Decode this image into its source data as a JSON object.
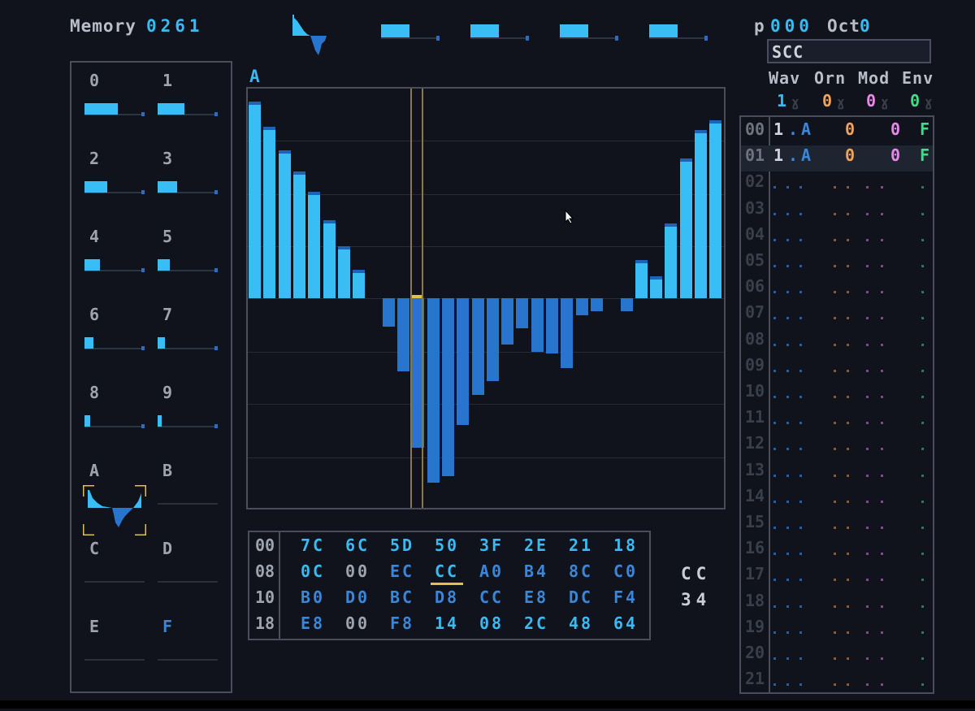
{
  "header": {
    "memory_label": "Memory",
    "memory_value": "0261",
    "pattern_label": "p",
    "pattern_value": "000",
    "octave_label": "Oct",
    "octave_value": "0"
  },
  "top_waves_fill": [
    0.48,
    0.48,
    0.48,
    0.48
  ],
  "slots": {
    "labels": [
      "0",
      "1",
      "2",
      "3",
      "4",
      "5",
      "6",
      "7",
      "8",
      "9",
      "A",
      "B",
      "C",
      "D",
      "E",
      "F"
    ],
    "fill": [
      0.55,
      0.45,
      0.38,
      0.33,
      0.25,
      0.2,
      0.15,
      0.12,
      0.09,
      0.07,
      null,
      null,
      null,
      null,
      null,
      null
    ],
    "selected": "A"
  },
  "wave_editor": {
    "title": "A",
    "cursor_index": 11,
    "chart_data": {
      "type": "bar",
      "values": [
        124,
        108,
        93,
        80,
        67,
        49,
        33,
        18,
        0,
        -18,
        -46,
        -94,
        -116,
        -112,
        -80,
        -61,
        -52,
        -29,
        -19,
        -34,
        -35,
        -44,
        -11,
        -8,
        0,
        -8,
        24,
        14,
        47,
        88,
        106,
        112
      ],
      "ylim": [
        -128,
        127
      ]
    }
  },
  "hex_table": {
    "rows": [
      {
        "addr": "00",
        "values": [
          "7C",
          "6C",
          "5D",
          "50",
          "3F",
          "2E",
          "21",
          "18"
        ]
      },
      {
        "addr": "08",
        "values": [
          "0C",
          "00",
          "EC",
          "CC",
          "A0",
          "B4",
          "8C",
          "C0"
        ]
      },
      {
        "addr": "10",
        "values": [
          "B0",
          "D0",
          "BC",
          "D8",
          "CC",
          "E8",
          "DC",
          "F4"
        ]
      },
      {
        "addr": "18",
        "values": [
          "E8",
          "00",
          "F8",
          "14",
          "08",
          "2C",
          "48",
          "64"
        ]
      }
    ],
    "cursor": {
      "row": 1,
      "col": 3
    },
    "side_value_1": "CC",
    "side_value_2": "34"
  },
  "instrument": {
    "name": "SCC",
    "columns": [
      "Wav",
      "Orn",
      "Mod",
      "Env"
    ],
    "column_values": [
      "1",
      "0",
      "0",
      "0"
    ]
  },
  "pattern": {
    "rows": [
      {
        "num": "00",
        "wav": "1",
        "sep": ".",
        "note": "A",
        "orn": "0",
        "mod": "0",
        "env": "F"
      },
      {
        "num": "01",
        "wav": "1",
        "sep": ".",
        "note": "A",
        "orn": "0",
        "mod": "0",
        "env": "F"
      },
      {
        "num": "02"
      },
      {
        "num": "03"
      },
      {
        "num": "04"
      },
      {
        "num": "05"
      },
      {
        "num": "06"
      },
      {
        "num": "07"
      },
      {
        "num": "08"
      },
      {
        "num": "09"
      },
      {
        "num": "10"
      },
      {
        "num": "11"
      },
      {
        "num": "12"
      },
      {
        "num": "13"
      },
      {
        "num": "14"
      },
      {
        "num": "15"
      },
      {
        "num": "16"
      },
      {
        "num": "17"
      },
      {
        "num": "18"
      },
      {
        "num": "19"
      },
      {
        "num": "20"
      },
      {
        "num": "21"
      }
    ]
  },
  "colors": {
    "bar_positive": "#39bdf5",
    "bar_negative": "#2875cd",
    "cursor": "#e2c049",
    "orn": "#f0a35a",
    "mod": "#e58ae8",
    "env": "#3fdc8a"
  }
}
